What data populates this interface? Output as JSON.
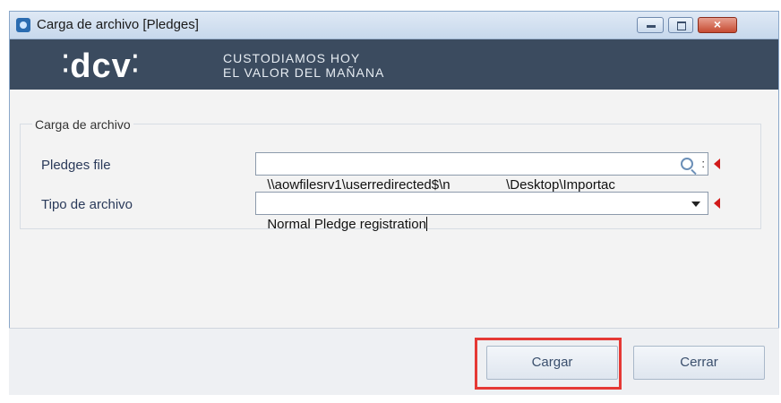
{
  "window": {
    "title": "Carga de archivo [Pledges]",
    "close_glyph": "×"
  },
  "banner": {
    "logo_text": "dcv",
    "tagline_line1": "CUSTODIAMOS HOY",
    "tagline_line2": "EL VALOR DEL MAÑANA"
  },
  "form": {
    "group_title": "Carga de archivo",
    "pledges_file": {
      "label": "Pledges file",
      "value": "\\\\aowfilesrv1\\userredirected$\\n               \\Desktop\\Importac",
      "ellipsis": ":"
    },
    "tipo_archivo": {
      "label": "Tipo de archivo",
      "value": "Normal Pledge registration"
    }
  },
  "buttons": {
    "cargar": "Cargar",
    "cerrar": "Cerrar"
  },
  "colors": {
    "banner": "#3b4b5f",
    "required_marker": "#d11a1a",
    "highlight": "#e53935"
  }
}
